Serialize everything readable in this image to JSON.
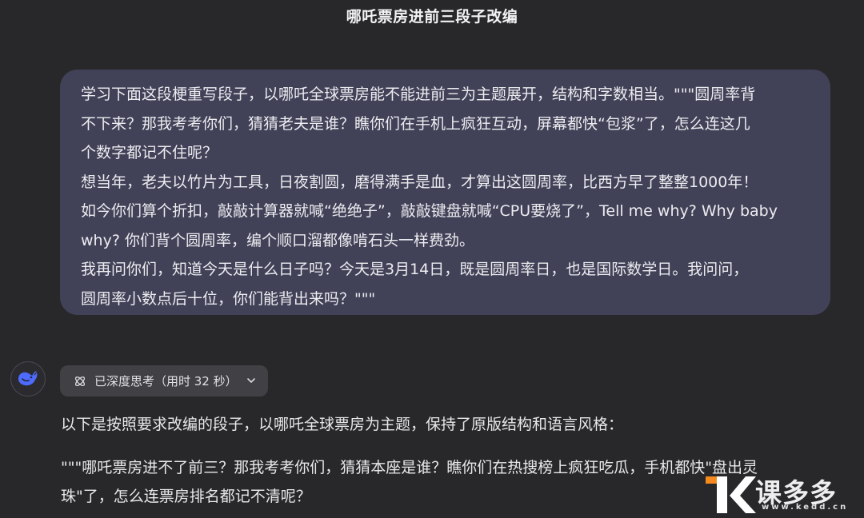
{
  "conversation": {
    "title": "哪吒票房进前三段子改编"
  },
  "user_message": {
    "lines": [
      "学习下面这段梗重写段子，以哪吒全球票房能不能进前三为主题展开，结构和字数相当。\"\"\"圆周率背",
      "不下来？那我考考你们，猜猜老夫是谁？瞧你们在手机上疯狂互动，屏幕都快“包浆”了，怎么连这几",
      "个数字都记不住呢？",
      "想当年，老夫以竹片为工具，日夜割圆，磨得满手是血，才算出这圆周率，比西方早了整整1000年！",
      "如今你们算个折扣，敲敲计算器就喊“绝绝子”，敲敲键盘就喊“CPU要烧了”，Tell me why? Why baby",
      "why? 你们背个圆周率，编个顺口溜都像啃石头一样费劲。",
      "我再问你们，知道今天是什么日子吗？今天是3月14日，既是圆周率日，也是国际数学日。我问问，",
      "圆周率小数点后十位，你们能背出来吗？\"\"\""
    ]
  },
  "assistant": {
    "avatar_icon": "whale-logo-icon",
    "thinking_label": "已深度思考（用时 32 秒）",
    "answer_intro": "以下是按照要求改编的段子，以哪吒全球票房为主题，保持了原版结构和语言风格：",
    "answer_lines": [
      "\"\"\"哪吒票房进不了前三？那我考考你们，猜猜本座是谁？瞧你们在热搜榜上疯狂吃瓜，手机都快\"盘出灵",
      "珠\"了，怎么连票房排名都记不清呢？"
    ]
  },
  "watermark": {
    "brand": "课多多",
    "url": "www.kedd.cn"
  },
  "colors": {
    "background": "#28282b",
    "user_bubble": "#414158",
    "thinking_chip": "#414145",
    "logo_blue": "#4d6bfe",
    "watermark_orange": "#f58a1f"
  }
}
